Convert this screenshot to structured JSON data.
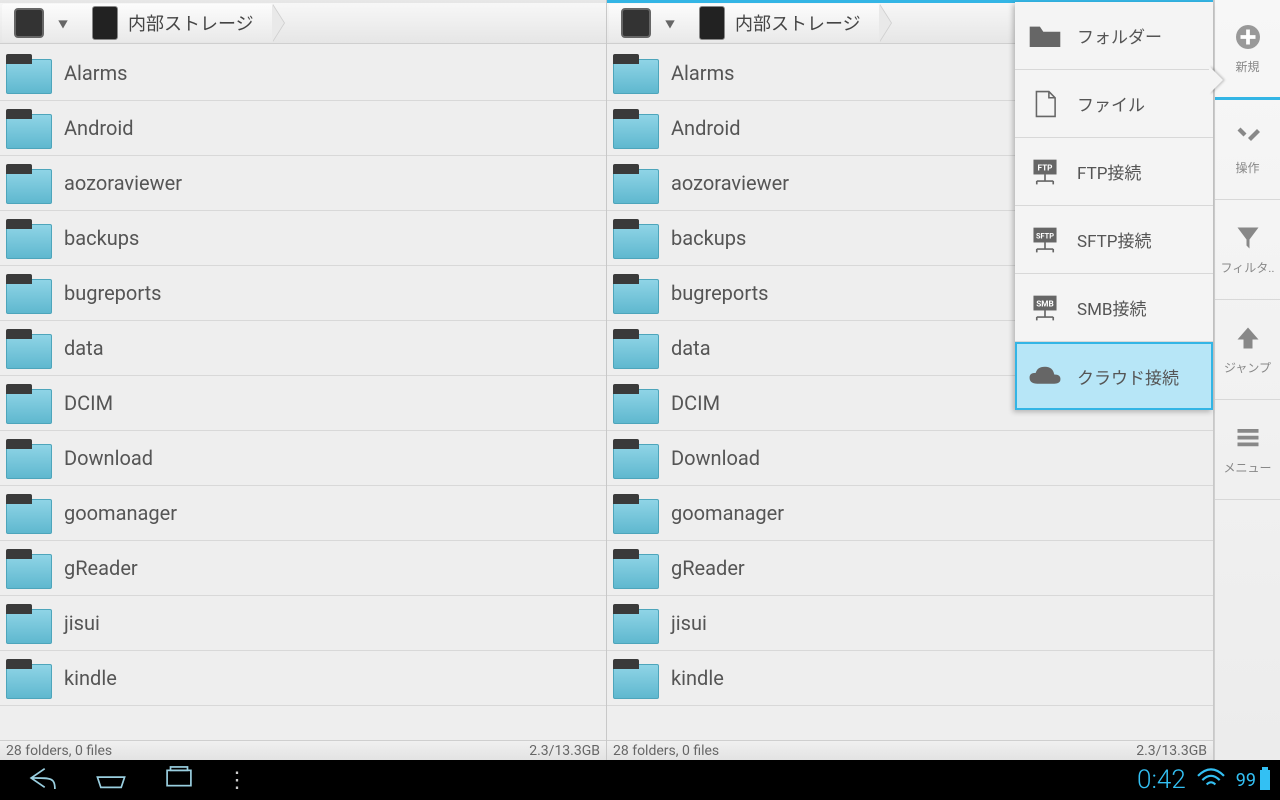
{
  "breadcrumb_label": "内部ストレージ",
  "pane_status_left": "28 folders, 0 files",
  "pane_status_right": "2.3/13.3GB",
  "folders": [
    "Alarms",
    "Android",
    "aozoraviewer",
    "backups",
    "bugreports",
    "data",
    "DCIM",
    "Download",
    "goomanager",
    "gReader",
    "jisui",
    "kindle"
  ],
  "dropdown": [
    {
      "label": "フォルダー",
      "icon": "folder",
      "highlight": false
    },
    {
      "label": "ファイル",
      "icon": "file",
      "highlight": false
    },
    {
      "label": "FTP接続",
      "icon": "ftp",
      "highlight": false
    },
    {
      "label": "SFTP接続",
      "icon": "sftp",
      "highlight": false
    },
    {
      "label": "SMB接続",
      "icon": "smb",
      "highlight": false
    },
    {
      "label": "クラウド接続",
      "icon": "cloud",
      "highlight": true
    }
  ],
  "sidebar": [
    {
      "label": "新規",
      "icon": "plus",
      "active": true
    },
    {
      "label": "操作",
      "icon": "tools",
      "active": false
    },
    {
      "label": "フィルタ..",
      "icon": "filter",
      "active": false
    },
    {
      "label": "ジャンプ",
      "icon": "up",
      "active": false
    },
    {
      "label": "メニュー",
      "icon": "menu",
      "active": false
    }
  ],
  "system": {
    "time": "0:42",
    "battery": "99"
  }
}
